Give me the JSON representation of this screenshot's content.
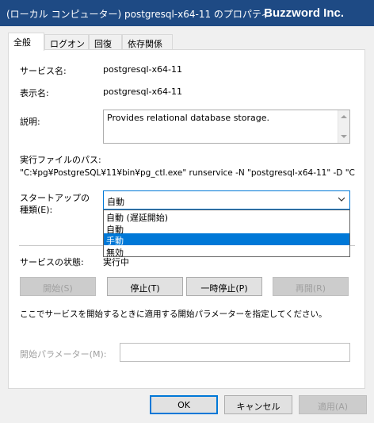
{
  "window": {
    "title": "(ローカル コンピューター) postgresql-x64-11 のプロパティ",
    "brand": "Buzzword Inc."
  },
  "tabs": [
    {
      "label": "全般",
      "active": true
    },
    {
      "label": "ログオン",
      "active": false
    },
    {
      "label": "回復",
      "active": false
    },
    {
      "label": "依存関係",
      "active": false
    }
  ],
  "general": {
    "service_name_label": "サービス名:",
    "service_name_value": "postgresql-x64-11",
    "display_name_label": "表示名:",
    "display_name_value": "postgresql-x64-11",
    "description_label": "説明:",
    "description_value": "Provides relational database storage.",
    "exe_path_label": "実行ファイルのパス:",
    "exe_path_value": "\"C:¥pg¥PostgreSQL¥11¥bin¥pg_ctl.exe\" runservice -N \"postgresql-x64-11\" -D \"C",
    "startup_type_label_line1": "スタートアップの",
    "startup_type_label_line2": "種類(E):",
    "startup_type_selected": "自動",
    "startup_type_options": [
      "自動 (遅延開始)",
      "自動",
      "手動",
      "無効"
    ],
    "startup_type_highlighted_index": 2,
    "service_status_label": "サービスの状態:",
    "service_status_value": "実行中",
    "buttons": {
      "start": "開始(S)",
      "stop": "停止(T)",
      "pause": "一時停止(P)",
      "resume": "再開(R)"
    },
    "start_params_note": "ここでサービスを開始するときに適用する開始パラメーターを指定してください。",
    "start_params_label": "開始パラメーター(M):",
    "start_params_value": ""
  },
  "footer": {
    "ok": "OK",
    "cancel": "キャンセル",
    "apply": "適用(A)"
  },
  "colors": {
    "titlebar": "#1e4a84",
    "selection": "#0078d7"
  }
}
